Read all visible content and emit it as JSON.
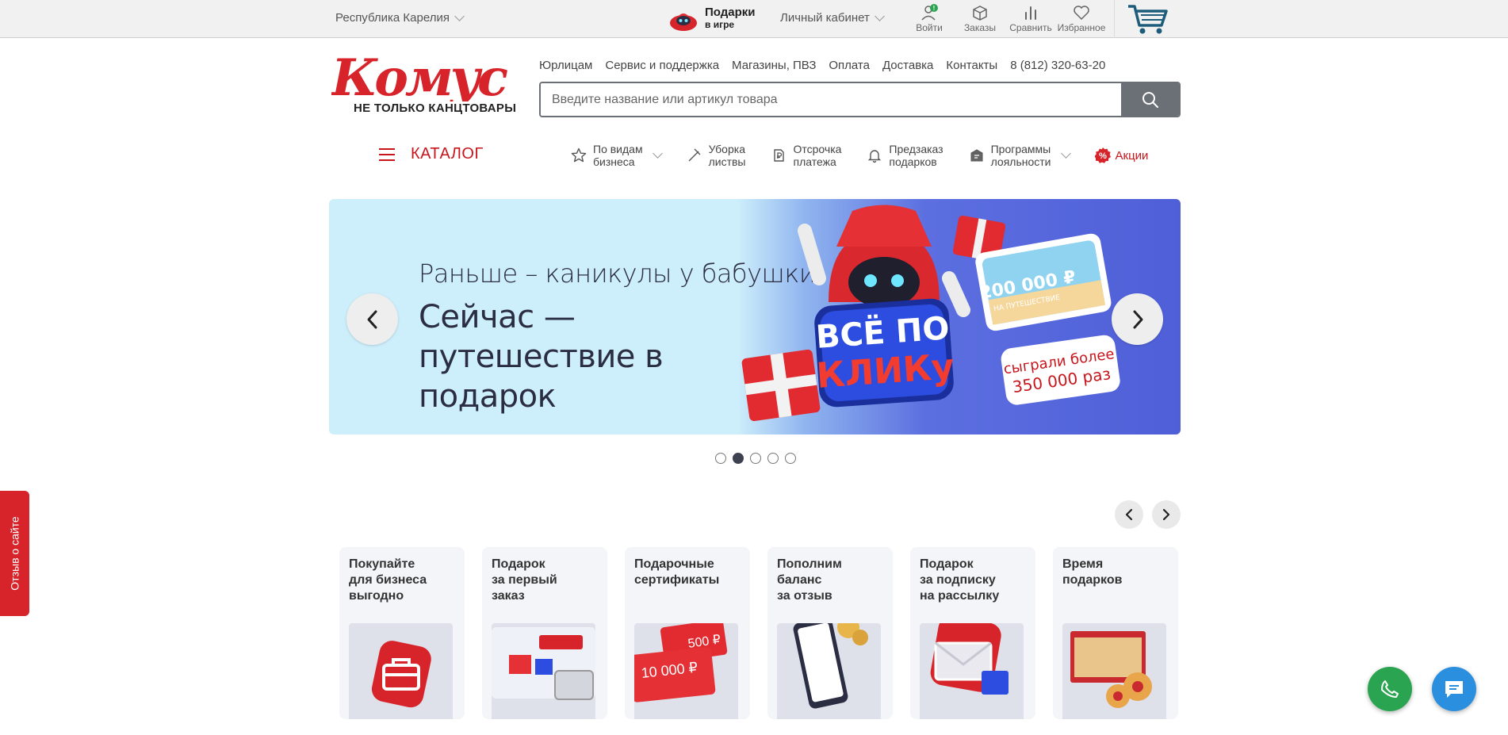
{
  "topbar": {
    "region": "Республика Карелия",
    "gifts_title": "Подарки",
    "gifts_sub": "в игре",
    "cabinet": "Личный кабинет",
    "icons": [
      {
        "label": "Войти",
        "icon": "user-icon"
      },
      {
        "label": "Заказы",
        "icon": "box-icon"
      },
      {
        "label": "Сравнить",
        "icon": "compare-icon"
      },
      {
        "label": "Избранное",
        "icon": "heart-icon"
      }
    ],
    "cart_icon": "cart-icon"
  },
  "header": {
    "logo_text": "Комус",
    "logo_sub": "НЕ ТОЛЬКО КАНЦТОВАРЫ",
    "links": [
      "Юрлицам",
      "Сервис и поддержка",
      "Магазины, ПВЗ",
      "Оплата",
      "Доставка",
      "Контакты",
      "8 (812) 320-63-20"
    ],
    "search_placeholder": "Введите название или артикул товара"
  },
  "nav": {
    "catalog": "КАТАЛОГ",
    "items": [
      {
        "label": "По видам\nбизнеса",
        "icon": "star-icon"
      },
      {
        "label": "Уборка\nлиствы",
        "icon": "rake-icon"
      },
      {
        "label": "Отсрочка\nплатежа",
        "icon": "ruble-icon"
      },
      {
        "label": "Предзаказ\nподарков",
        "icon": "bell-icon"
      },
      {
        "label": "Программы\nлояльности",
        "icon": "loyalty-icon"
      }
    ],
    "promo": "Акции",
    "promo_badge": "%"
  },
  "banner": {
    "line1": "Раньше – каникулы у бабушки",
    "line2": "Сейчас — путешествие в подарок",
    "badge": "ВСЁ ПО КЛИКу",
    "ticket_amount": "200 000 ₽",
    "ticket_caption": "НА ПУТЕШЕСТВИЕ",
    "played_line1": "сыграли более",
    "played_line2": "350 000 раз",
    "slide_count": 5,
    "active_slide": 2
  },
  "cards": [
    {
      "title": "Покупайте\nдля бизнеса\nвыгодно"
    },
    {
      "title": "Подарок\nза первый\nзаказ"
    },
    {
      "title": "Подарочные\nсертификаты",
      "cert1": "500 ₽",
      "cert2": "10 000 ₽"
    },
    {
      "title": "Пополним\nбаланс\nза отзыв"
    },
    {
      "title": "Подарок\nза подписку\nна рассылку"
    },
    {
      "title": "Время\nподарков"
    }
  ],
  "feedback_tab": "Отзыв о сайте",
  "colors": {
    "brand": "#c8161d",
    "accent": "#d7232a",
    "dark": "#3d4150",
    "green": "#2aa451",
    "blue": "#2a8fde"
  }
}
